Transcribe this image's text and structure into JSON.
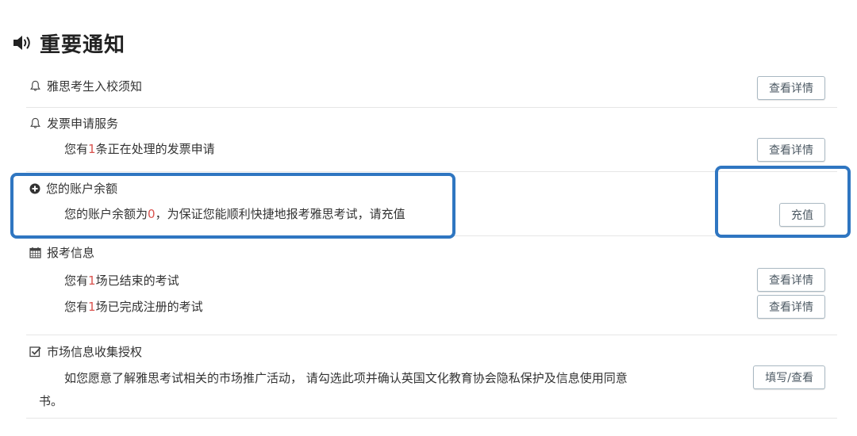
{
  "page": {
    "title": "重要通知",
    "speaker_icon": "speaker-icon"
  },
  "sections": {
    "school_notice": {
      "icon": "bell-icon",
      "heading": "雅思考生入校须知",
      "button": "查看详情"
    },
    "invoice": {
      "icon": "bell-icon",
      "heading": "发票申请服务",
      "line_pre": "您有",
      "line_num": "1",
      "line_post": "条正在处理的发票申请",
      "button": "查看详情"
    },
    "balance": {
      "icon": "plus-circle-icon",
      "heading": "您的账户余额",
      "line_pre": "您的账户余额为",
      "line_num": "0",
      "line_post": "，为保证您能顺利快捷地报考雅思考试，请充值",
      "button": "充值"
    },
    "registration": {
      "icon": "calendar-icon",
      "heading": "报考信息",
      "line1_pre": "您有",
      "line1_num": "1",
      "line1_post": "场已结束的考试",
      "button1": "查看详情",
      "line2_pre": "您有",
      "line2_num": "1",
      "line2_post": "场已完成注册的考试",
      "button2": "查看详情"
    },
    "marketing": {
      "icon": "checkbox-icon",
      "heading": "市场信息收集授权",
      "line1": "如您愿意了解雅思考试相关的市场推广活动， 请勾选此项并确认英国文化教育协会隐私保护及信息使用同意",
      "line2": "书。",
      "button": "填写/查看"
    }
  },
  "colors": {
    "highlight": "#2f76c1",
    "number": "#d9534f"
  }
}
